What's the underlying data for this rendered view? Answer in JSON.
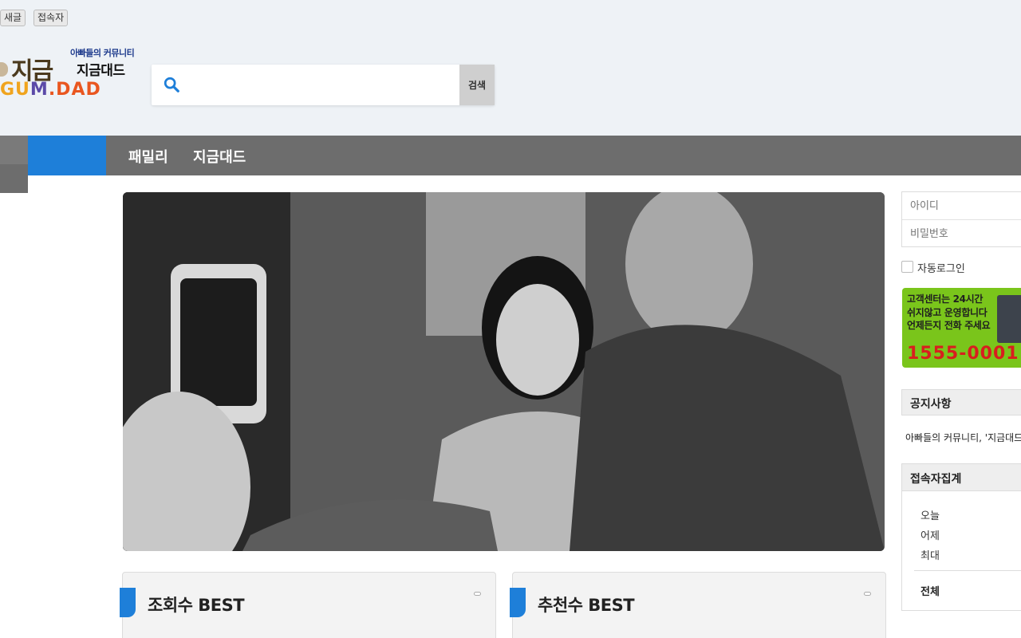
{
  "top_buttons": {
    "new_posts": "새글",
    "visitors": "접속자"
  },
  "logo": {
    "tagline": "아빠들의 커뮤니티",
    "name": "지금대드",
    "mark": "지금",
    "domain_a": "GU",
    "domain_b": "M",
    "domain_c": ".DAD"
  },
  "search": {
    "placeholder": "",
    "button_label": "검색"
  },
  "nav": {
    "items": [
      {
        "label": "패밀리"
      },
      {
        "label": "지금대드"
      }
    ]
  },
  "best": {
    "views_title": "조회수 BEST",
    "recommend_title": "추천수 BEST"
  },
  "login": {
    "id_placeholder": "아이디",
    "password_placeholder": "비밀번호",
    "autologin_label": "자동로그인"
  },
  "cs_banner": {
    "line1": "고객센터는 24시간",
    "line2": "쉬지않고 운영합니다",
    "line3": "언제든지 전화 주세요",
    "phone": "1555-0001"
  },
  "notice": {
    "title": "공지사항",
    "text": "아빠들의 커뮤니티, '지금대드'"
  },
  "stats": {
    "title": "접속자집계",
    "today": "오늘",
    "yesterday": "어제",
    "max": "최대",
    "total": "전체"
  },
  "colors": {
    "accent_blue": "#1e7fd9",
    "nav_gray": "#6d6d6d",
    "banner_green": "#7ac51b",
    "phone_red": "#d81e1e"
  }
}
